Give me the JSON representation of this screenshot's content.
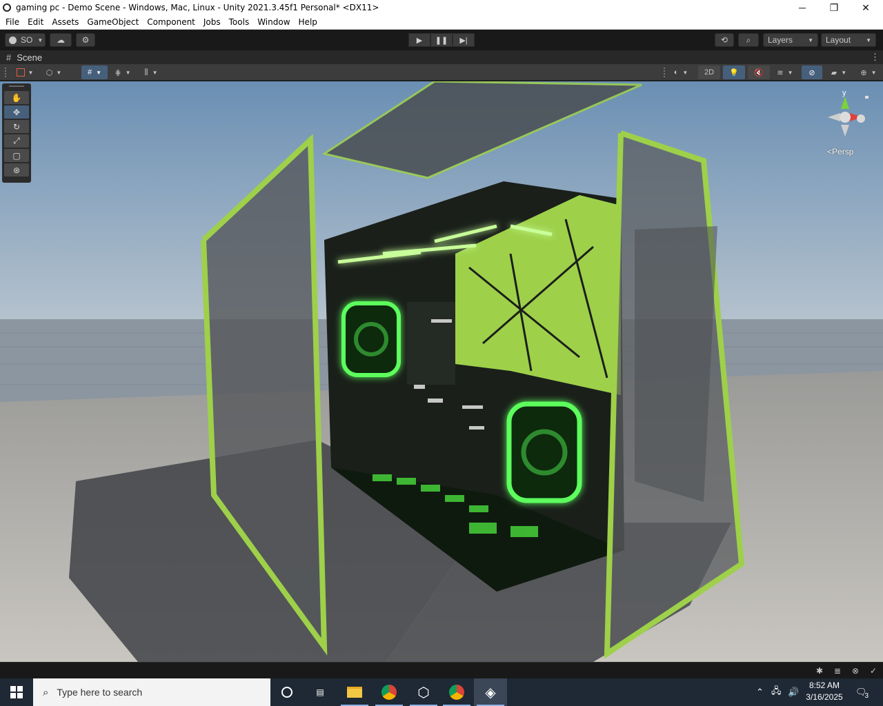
{
  "window": {
    "title": "gaming pc - Demo Scene - Windows, Mac, Linux - Unity 2021.3.45f1 Personal* <DX11>",
    "minimize": "─",
    "maximize": "❐",
    "close": "✕"
  },
  "menu": [
    "File",
    "Edit",
    "Assets",
    "GameObject",
    "Component",
    "Jobs",
    "Tools",
    "Window",
    "Help"
  ],
  "toolbar": {
    "account": "SO",
    "layers": "Layers",
    "layout": "Layout"
  },
  "scene_tab": {
    "label": "Scene"
  },
  "scene_toolbar": {
    "mode_2d": "2D"
  },
  "viewport": {
    "camera_label": "Persp",
    "gizmo_axis": "y"
  },
  "taskbar": {
    "search_placeholder": "Type here to search",
    "time": "8:52 AM",
    "date": "3/16/2025",
    "notifications": "3"
  },
  "colors": {
    "accent_blue": "#46607c",
    "neon_green": "#4dff4d",
    "panel_green": "#9ed04a",
    "taskbar": "#1f2835"
  },
  "icons": {
    "tools": [
      "hand-icon",
      "move-icon",
      "rotate-icon",
      "scale-icon",
      "rect-icon",
      "transform-icon"
    ]
  }
}
